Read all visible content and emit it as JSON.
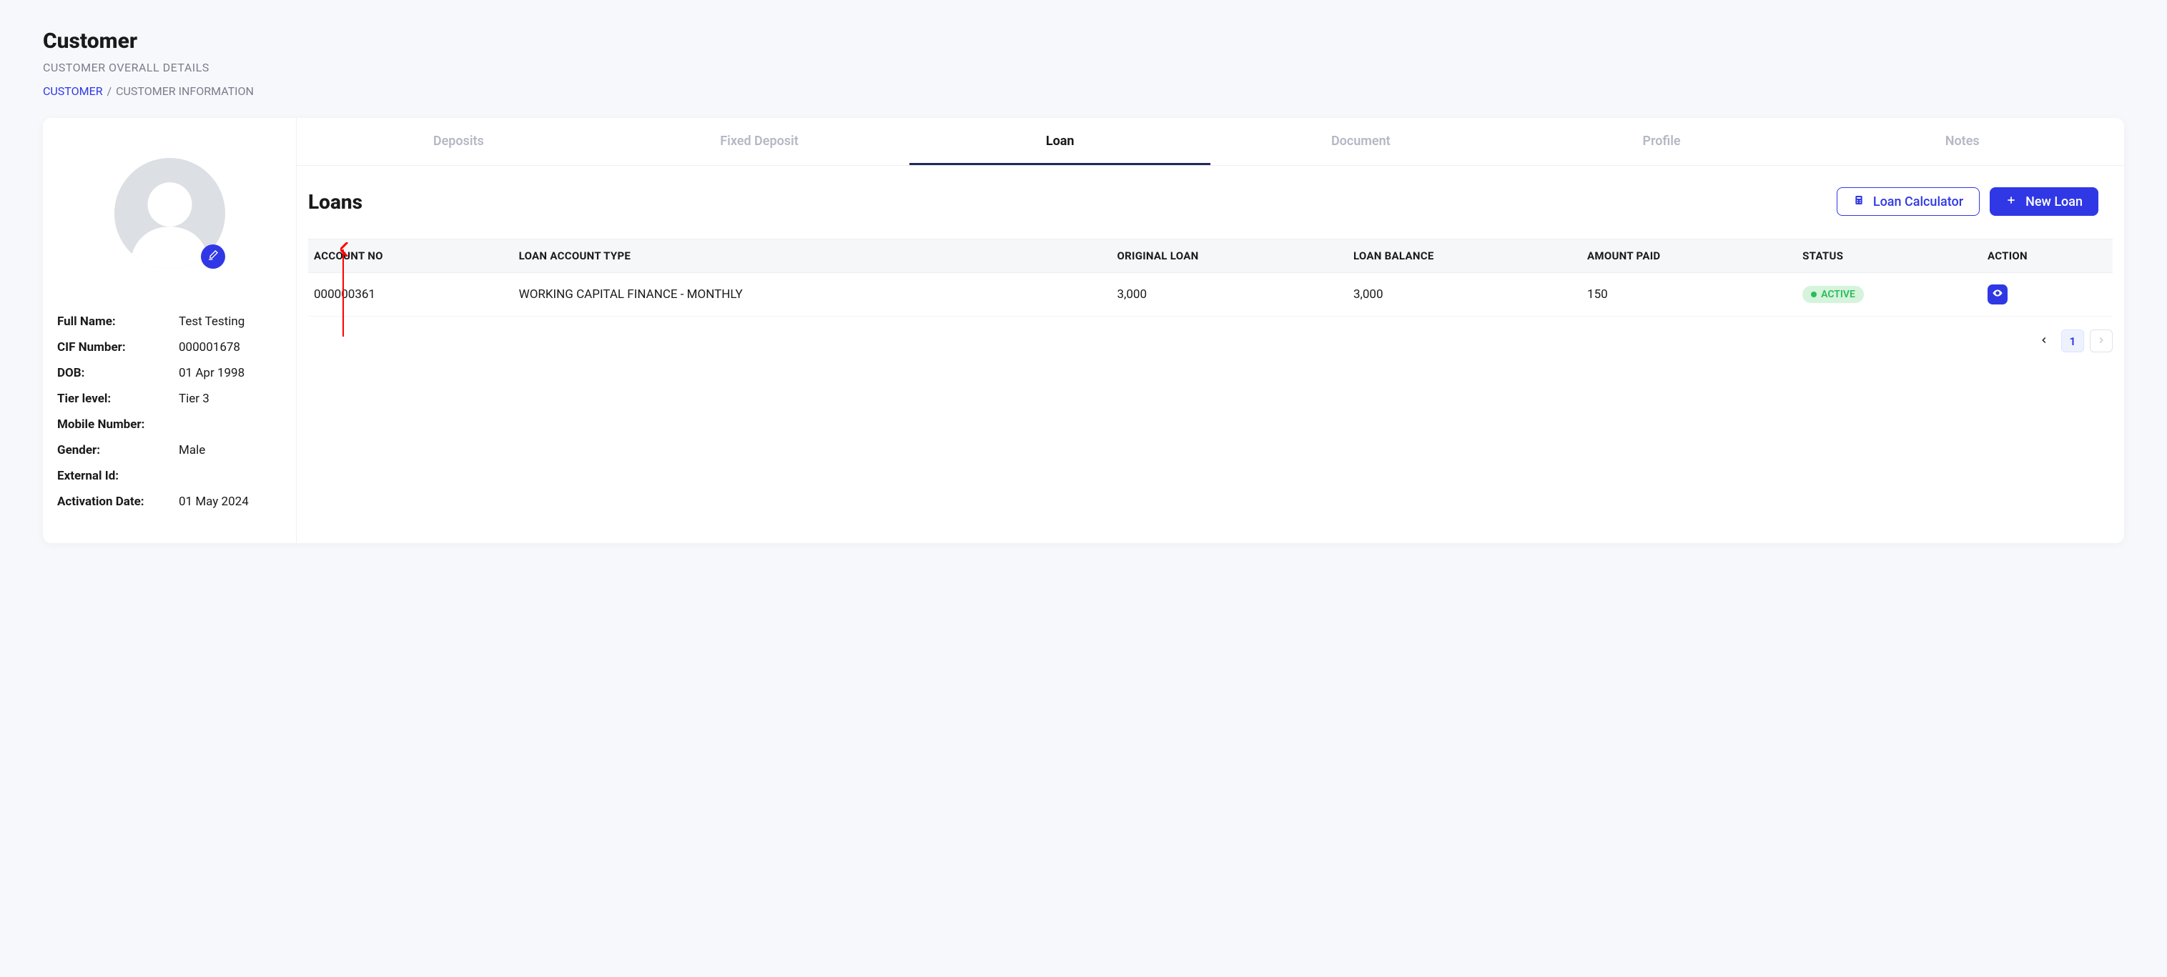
{
  "header": {
    "title": "Customer",
    "subtitle": "CUSTOMER OVERALL DETAILS"
  },
  "breadcrumb": {
    "link": "CUSTOMER",
    "sep": "/",
    "current": "CUSTOMER INFORMATION"
  },
  "profile": {
    "fields": [
      {
        "label": "Full Name:",
        "value": "Test Testing"
      },
      {
        "label": "CIF Number:",
        "value": "000001678"
      },
      {
        "label": "DOB:",
        "value": "01 Apr 1998"
      },
      {
        "label": "Tier level:",
        "value": "Tier 3"
      },
      {
        "label": "Mobile Number:",
        "value": ""
      },
      {
        "label": "Gender:",
        "value": "Male"
      },
      {
        "label": "External Id:",
        "value": ""
      },
      {
        "label": "Activation Date:",
        "value": "01 May 2024"
      }
    ]
  },
  "tabs": [
    {
      "label": "Deposits",
      "active": false
    },
    {
      "label": "Fixed Deposit",
      "active": false
    },
    {
      "label": "Loan",
      "active": true
    },
    {
      "label": "Document",
      "active": false
    },
    {
      "label": "Profile",
      "active": false
    },
    {
      "label": "Notes",
      "active": false
    }
  ],
  "section": {
    "title": "Loans",
    "calc_label": "Loan Calculator",
    "new_label": "New Loan"
  },
  "table": {
    "columns": [
      "ACCOUNT NO",
      "LOAN ACCOUNT TYPE",
      "ORIGINAL LOAN",
      "LOAN BALANCE",
      "AMOUNT PAID",
      "STATUS",
      "ACTION"
    ],
    "rows": [
      {
        "account_no": "000000361",
        "type": "WORKING CAPITAL FINANCE - MONTHLY",
        "original": "3,000",
        "balance": "3,000",
        "paid": "150",
        "status": "ACTIVE"
      }
    ]
  },
  "pagination": {
    "current": "1"
  },
  "colors": {
    "primary": "#3038e5",
    "status_active_bg": "#d6f3dc",
    "status_active_fg": "#28bd5a"
  }
}
